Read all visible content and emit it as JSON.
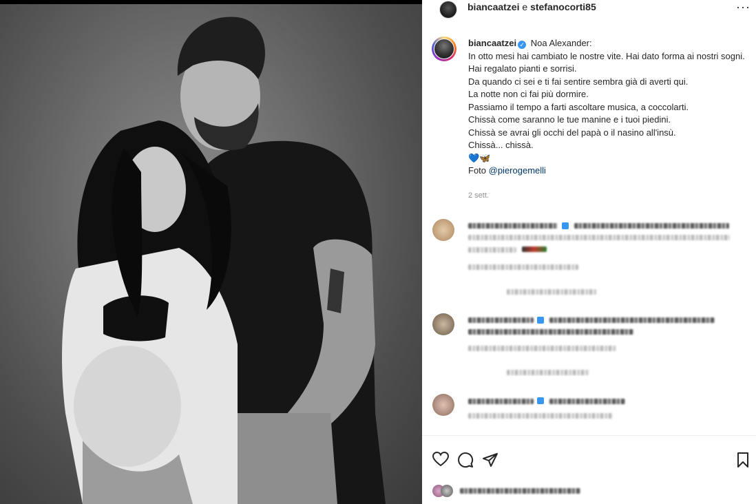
{
  "post": {
    "header": {
      "user1": "biancaatzei",
      "joiner": " e ",
      "user2": "stefanocorti85",
      "more_icon": "more-horizontal-icon"
    },
    "caption": {
      "username": "biancaatzei",
      "verified_icon": "verified-badge-icon",
      "lines": [
        "Noa Alexander:",
        "In otto mesi hai cambiato le nostre vite. Hai dato forma ai nostri sogni.",
        "Hai regalato pianti e sorrisi.",
        "Da quando ci sei e ti fai sentire sembra già di averti qui.",
        "La notte non ci fai più dormire.",
        "Passiamo il tempo a farti ascoltare musica, a coccolarti.",
        "Chissà come saranno le tue manine e i tuoi piedini.",
        "Chissà se avrai gli occhi del papà o il nasino all'insù.",
        "Chissà... chissà."
      ],
      "emoji_heart": "💙",
      "emoji_butterfly": "🦋",
      "photo_prefix": "Foto ",
      "photo_mention": "@pierogemelli",
      "time_ago": "2 sett."
    },
    "actions": {
      "like_icon": "heart-icon",
      "comment_icon": "comment-icon",
      "share_icon": "send-icon",
      "save_icon": "bookmark-icon"
    },
    "colors": {
      "link": "#00376b",
      "verified": "#3897f0",
      "muted": "#8e8e8e"
    }
  }
}
